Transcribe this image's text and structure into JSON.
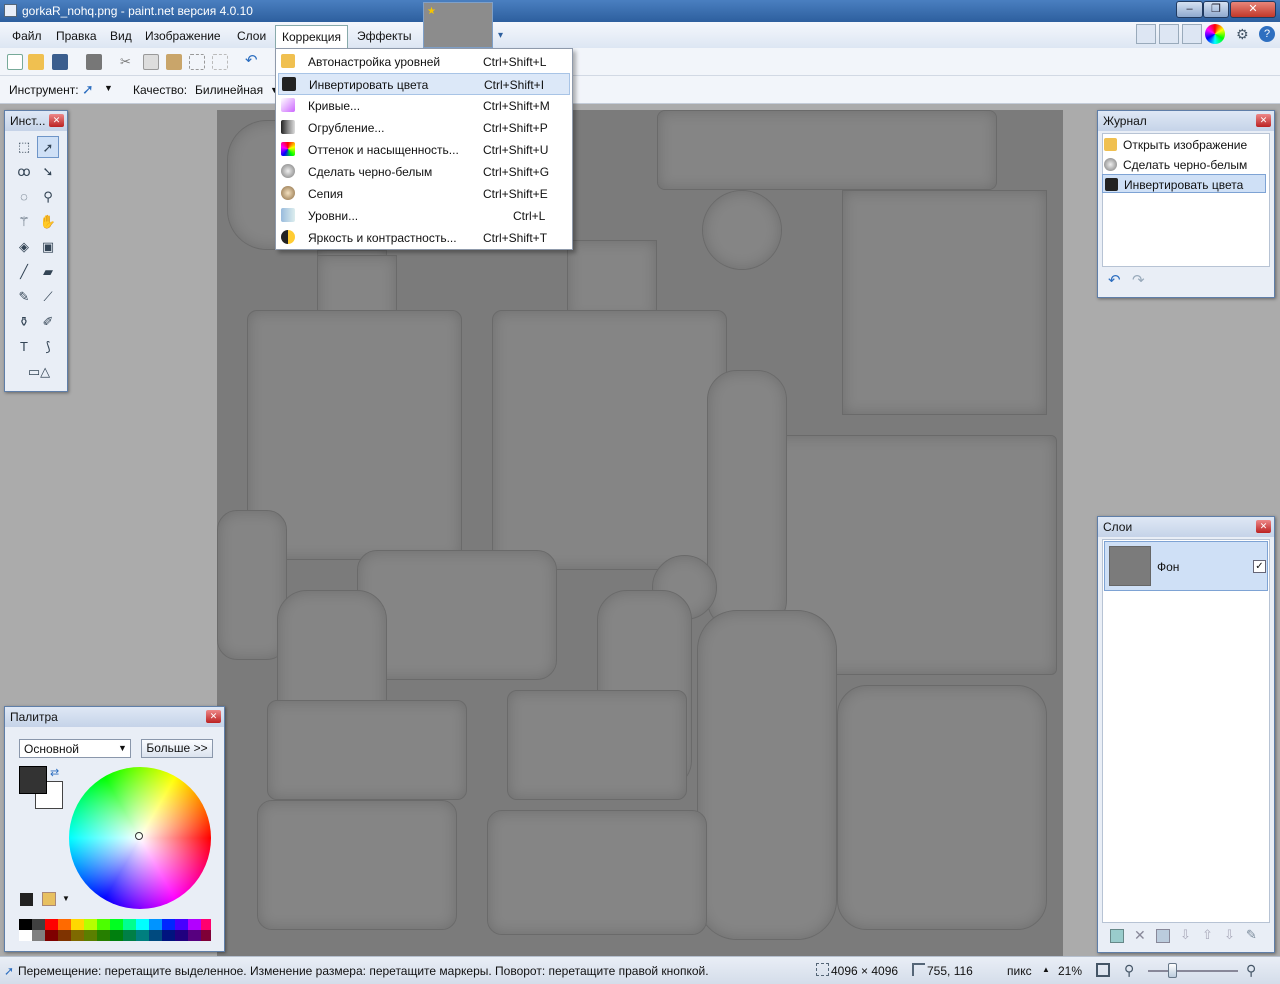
{
  "window": {
    "title": "gorkaR_nohq.png - paint.net версия 4.0.10"
  },
  "menu": {
    "items": [
      "Файл",
      "Правка",
      "Вид",
      "Изображение",
      "Слои",
      "Коррекция",
      "Эффекты"
    ],
    "open_index": 5
  },
  "toolbar2": {
    "tool_label": "Инструмент:",
    "quality_label": "Качество:",
    "quality_value": "Билинейная"
  },
  "dropdown": {
    "items": [
      {
        "label": "Автонастройка уровней",
        "shortcut": "Ctrl+Shift+L",
        "icon": "auto-level-icon"
      },
      {
        "label": "Инвертировать цвета",
        "shortcut": "Ctrl+Shift+I",
        "icon": "invert-colors-icon",
        "highlighted": true
      },
      {
        "label": "Кривые...",
        "shortcut": "Ctrl+Shift+M",
        "icon": "curves-icon"
      },
      {
        "label": "Огрубление...",
        "shortcut": "Ctrl+Shift+P",
        "icon": "posterize-icon"
      },
      {
        "label": "Оттенок и насыщенность...",
        "shortcut": "Ctrl+Shift+U",
        "icon": "hue-saturation-icon"
      },
      {
        "label": "Сделать черно-белым",
        "shortcut": "Ctrl+Shift+G",
        "icon": "black-white-icon"
      },
      {
        "label": "Сепия",
        "shortcut": "Ctrl+Shift+E",
        "icon": "sepia-icon"
      },
      {
        "label": "Уровни...",
        "shortcut": "Ctrl+L",
        "icon": "levels-icon"
      },
      {
        "label": "Яркость и контрастность...",
        "shortcut": "Ctrl+Shift+T",
        "icon": "brightness-contrast-icon"
      }
    ]
  },
  "tools_panel": {
    "title": "Инст..."
  },
  "history_panel": {
    "title": "Журнал",
    "items": [
      {
        "label": "Открыть изображение"
      },
      {
        "label": "Сделать черно-белым"
      },
      {
        "label": "Инвертировать цвета",
        "selected": true
      }
    ]
  },
  "layers_panel": {
    "title": "Слои",
    "layers": [
      {
        "name": "Фон",
        "visible": true
      }
    ]
  },
  "palette_panel": {
    "title": "Палитра",
    "mode": "Основной",
    "more_button": "Больше >>"
  },
  "statusbar": {
    "hint": "Перемещение: перетащите выделенное. Изменение размера: перетащите маркеры. Поворот: перетащите правой кнопкой.",
    "image_size": "4096 × 4096",
    "cursor_pos": "755, 116",
    "units": "пикс",
    "zoom": "21%"
  },
  "colors": {
    "accent": "#2d5f9e",
    "canvas": "#7b7b7b",
    "selection": "#cfe0f6"
  }
}
